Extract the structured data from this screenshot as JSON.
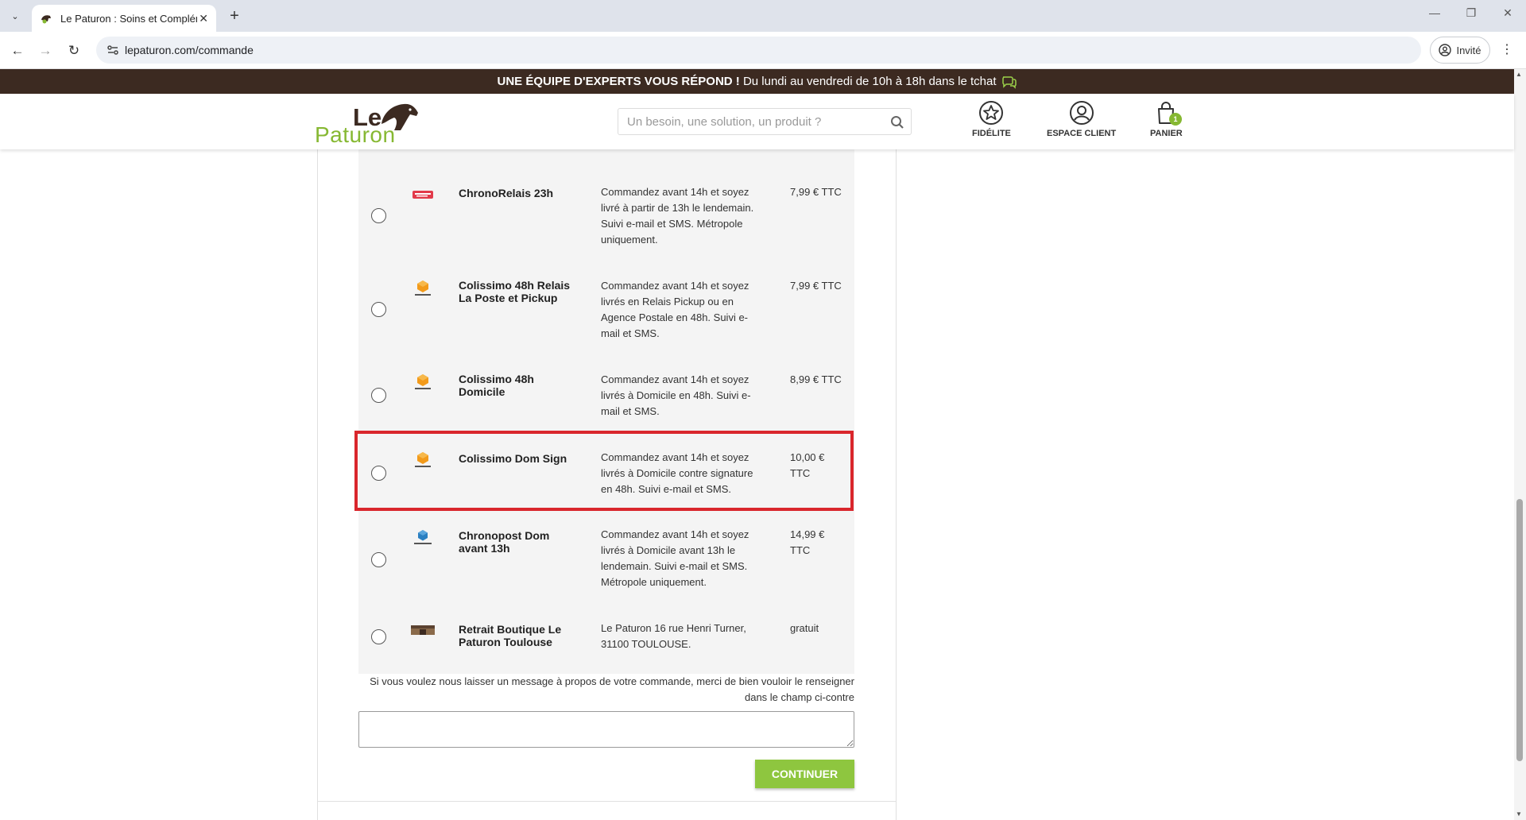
{
  "browser": {
    "tab_title": "Le Paturon : Soins et Compléments",
    "url": "lepaturon.com/commande",
    "profile_label": "Invité"
  },
  "banner": {
    "bold_text": "UNE ÉQUIPE D'EXPERTS VOUS RÉPOND !",
    "text": " Du lundi au vendredi de 10h à 18h dans le tchat"
  },
  "header": {
    "logo_top": "Le",
    "logo_bottom": "Paturon",
    "search_placeholder": "Un besoin, une solution, un produit ?",
    "fidelite_label": "FIDÉLITE",
    "espace_client_label": "ESPACE CLIENT",
    "panier_label": "PANIER",
    "cart_count": "1"
  },
  "carriers": [
    {
      "name": "ChronoRelais 23h",
      "description": "Commandez avant 14h et soyez livré à partir de 13h le lendemain. Suivi e-mail et SMS. Métropole uniquement.",
      "price": "7,99 € TTC",
      "logo": "chronorelais-logo"
    },
    {
      "name": "Colissimo 48h Relais La Poste et Pickup",
      "description": "Commandez avant 14h et soyez livrés en Relais Pickup ou en Agence Postale en 48h. Suivi e-mail et SMS.",
      "price": "7,99 € TTC",
      "logo": "colissimo-logo"
    },
    {
      "name": "Colissimo 48h Domicile",
      "description": "Commandez avant 14h et soyez livrés à Domicile en 48h. Suivi e-mail et SMS.",
      "price": "8,99 € TTC",
      "logo": "colissimo-logo"
    },
    {
      "name": "Colissimo Dom Sign",
      "description": "Commandez avant 14h et soyez livrés à Domicile contre signature en 48h. Suivi e-mail et SMS.",
      "price": "10,00 € TTC",
      "logo": "colissimo-logo",
      "highlighted": true
    },
    {
      "name": "Chronopost Dom avant 13h",
      "description": "Commandez avant 14h et soyez livrés à Domicile avant 13h le lendemain. Suivi e-mail et SMS. Métropole uniquement.",
      "price": "14,99 € TTC",
      "logo": "chronopost-logo"
    },
    {
      "name": "Retrait Boutique Le Paturon Toulouse",
      "description": "Le Paturon 16 rue Henri Turner, 31100 TOULOUSE.",
      "price": "gratuit",
      "logo": "boutique-photo"
    }
  ],
  "message": {
    "prompt": "Si vous voulez nous laisser un message à propos de votre commande, merci de bien vouloir le renseigner dans le champ ci-contre",
    "value": ""
  },
  "continue_label": "CONTINUER",
  "colors": {
    "banner_bg": "#3c2a21",
    "brand_green": "#8ec63f",
    "highlight_red": "#d9262c"
  }
}
